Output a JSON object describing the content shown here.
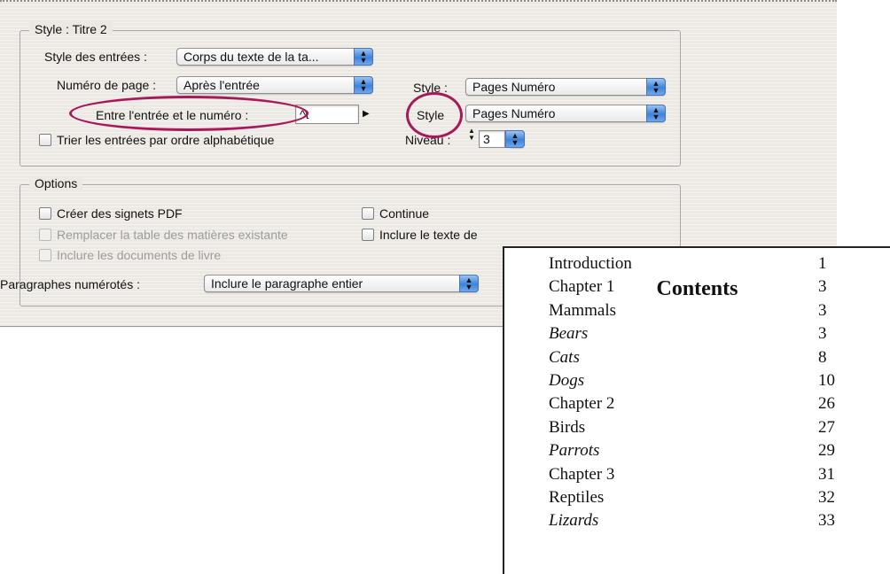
{
  "style_group": {
    "legend": "Style : Titre 2",
    "entry_style_label": "Style des entrées :",
    "entry_style_value": "Corps du texte de la ta...",
    "page_number_label": "Numéro de page :",
    "page_number_value": "Après l'entrée",
    "page_style_label": "Style :",
    "page_style_value": "Pages Numéro",
    "between_label": "Entre l'entrée et le numéro :",
    "between_value": "^t",
    "between_style_label": "Style",
    "between_style_value": "Pages Numéro",
    "sort_label": "Trier les entrées par ordre alphabétique",
    "level_label": "Niveau :",
    "level_value": "3"
  },
  "options_group": {
    "legend": "Options",
    "pdf_bookmarks_label": "Créer des signets PDF",
    "replace_toc_label": "Remplacer la table des matières existante",
    "include_book_label": "Inclure les documents de livre",
    "continue_label": "Continue",
    "include_text_label": "Inclure le texte de",
    "numbered_paragraphs_label": "Paragraphes numérotés :",
    "numbered_paragraphs_value": "Inclure le paragraphe entier"
  },
  "toc": {
    "title": "Contents",
    "entries": [
      {
        "title": "Introduction",
        "page": "1",
        "italic": false
      },
      {
        "title": "Chapter 1",
        "page": "3",
        "italic": false
      },
      {
        "title": "Mammals",
        "page": "3",
        "italic": false
      },
      {
        "title": "Bears",
        "page": "3",
        "italic": true
      },
      {
        "title": "Cats",
        "page": "8",
        "italic": true
      },
      {
        "title": "Dogs",
        "page": "10",
        "italic": true
      },
      {
        "title": "Chapter 2",
        "page": "26",
        "italic": false
      },
      {
        "title": "Birds",
        "page": "27",
        "italic": false
      },
      {
        "title": "Parrots",
        "page": "29",
        "italic": true
      },
      {
        "title": "Chapter 3",
        "page": "31",
        "italic": false
      },
      {
        "title": "Reptiles",
        "page": "32",
        "italic": false
      },
      {
        "title": "Lizards",
        "page": "33",
        "italic": true
      }
    ]
  },
  "colors": {
    "highlight_circle": "#a6195a",
    "dialog_background": "#ece9e4",
    "popup_arrow_blue": "#3f82d9"
  },
  "icons": {
    "popup_arrows": "up-down-arrows-icon",
    "special_char_menu": "triangle-right-icon"
  }
}
